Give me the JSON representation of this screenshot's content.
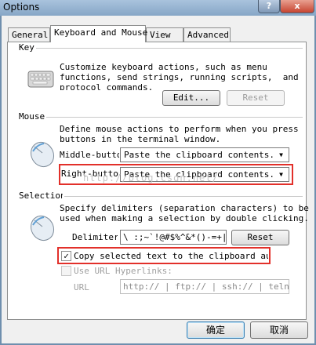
{
  "window": {
    "title": "Options",
    "help_glyph": "?",
    "close_glyph": "x"
  },
  "tabs": [
    {
      "label": "General"
    },
    {
      "label": "Keyboard and Mouse"
    },
    {
      "label": "View"
    },
    {
      "label": "Advanced"
    }
  ],
  "key": {
    "section": "Key",
    "description": "Customize keyboard actions, such as menu\nfunctions, send strings, running scripts,  and\nprotocol commands.",
    "edit_button": "Edit...",
    "reset_button": "Reset"
  },
  "mouse": {
    "section": "Mouse",
    "description": "Define mouse actions to perform when you press\nbuttons in the terminal window.",
    "middle_label": "Middle-button:",
    "middle_value": "Paste the clipboard contents.",
    "right_label": "Right-button:",
    "right_value": "Paste the clipboard contents."
  },
  "selection": {
    "section": "Selection",
    "description": "Specify delimiters (separation characters) to be\nused when making a selection by double clicking.",
    "delimiters_label": "Delimiters:",
    "delimiters_value": "\\ :;~`!@#$%^&*()-=+|[]{}'\",.<>/?",
    "reset_button": "Reset",
    "copy_label": "Copy selected text to the clipboard automatically",
    "copy_checked": true,
    "url_hyperlinks_label": "Use URL Hyperlinks:",
    "url_hyperlinks_checked": false,
    "url_label": "URL",
    "url_value": "http:// | ftp:// | ssh:// | telnet:// |"
  },
  "footer": {
    "ok_button": "确定",
    "cancel_button": "取消"
  },
  "watermark": "http://blog.csdn.net/",
  "colors": {
    "highlight": "#e2302a",
    "accent": "#3c7fb1"
  },
  "icons": [
    "keyboard-icon",
    "mouse-icon",
    "mouse-icon",
    "dropdown-arrow-icon"
  ]
}
